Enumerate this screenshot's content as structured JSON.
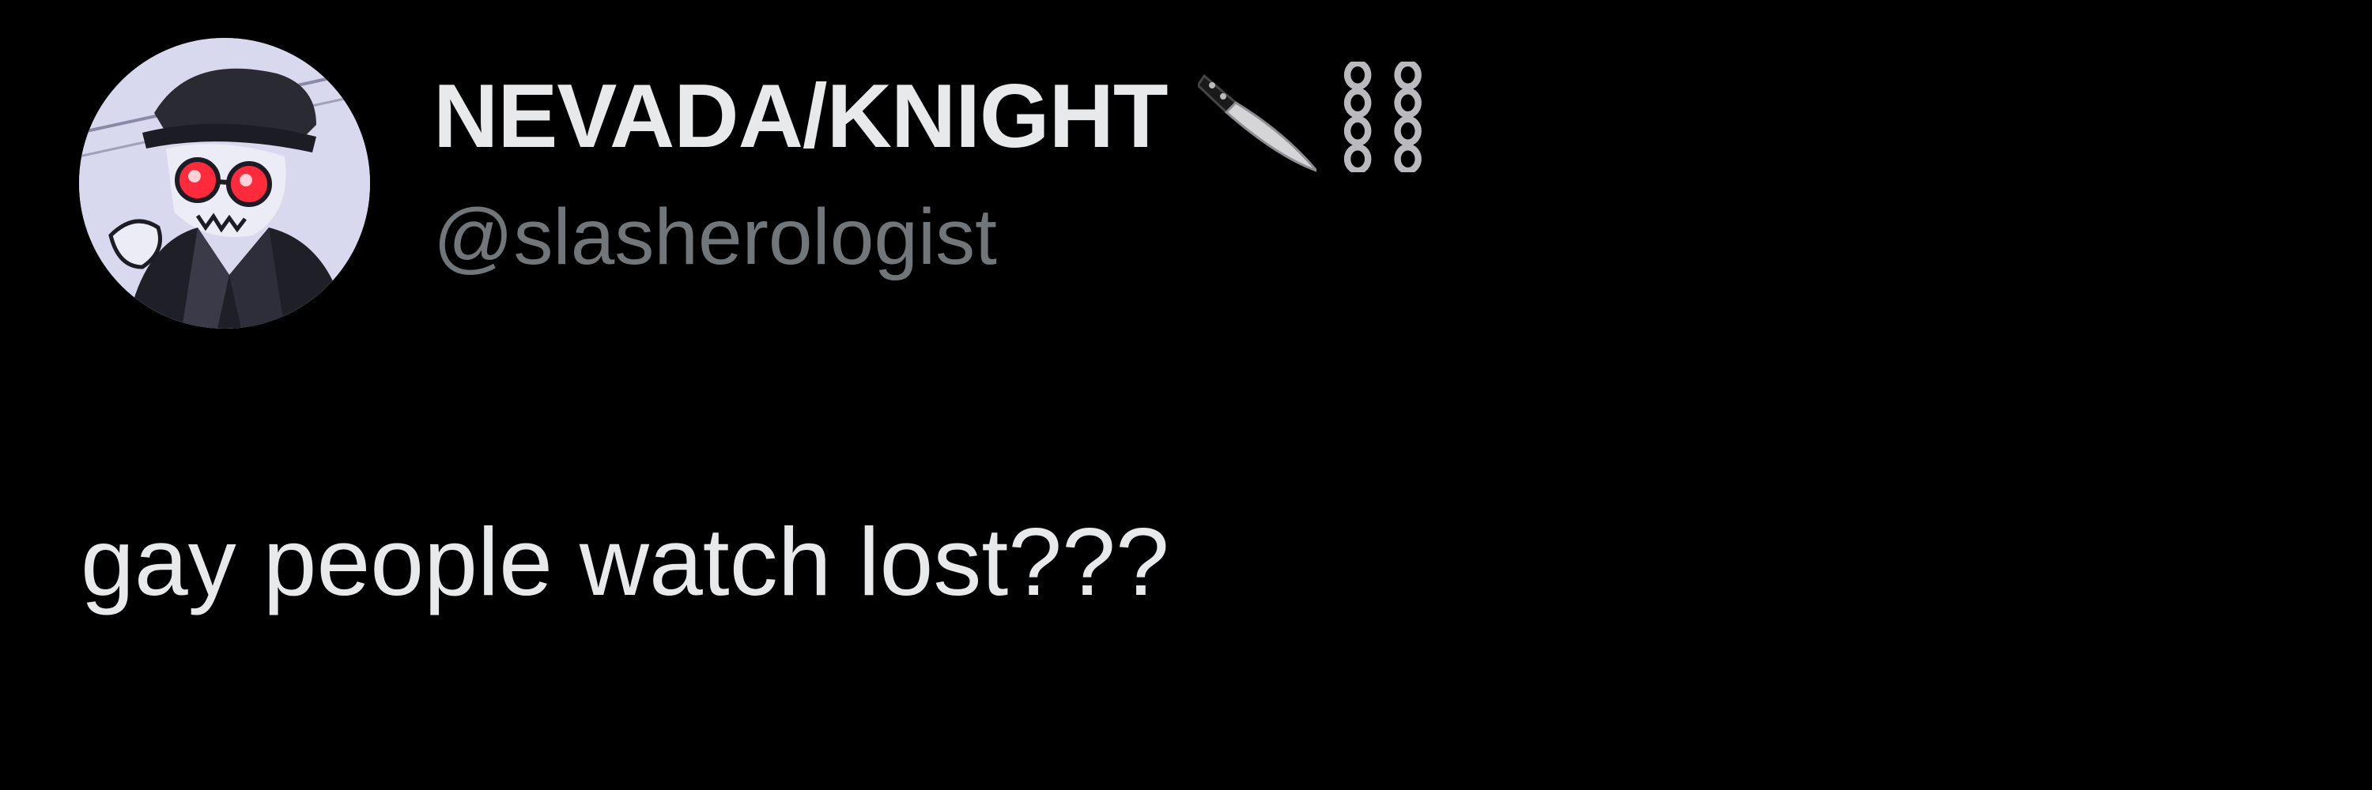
{
  "tweet": {
    "author": {
      "display_name": "NEVADA/KNIGHT",
      "handle": "@slasherologist",
      "name_icons": [
        "knife-icon",
        "chain-icon"
      ],
      "avatar": "avatar-illustration"
    },
    "text": "gay people watch lost???"
  },
  "colors": {
    "background": "#000000",
    "primary_text": "#e7e9ea",
    "secondary_text": "#71767b",
    "avatar_glasses": "#ff2a3c"
  }
}
